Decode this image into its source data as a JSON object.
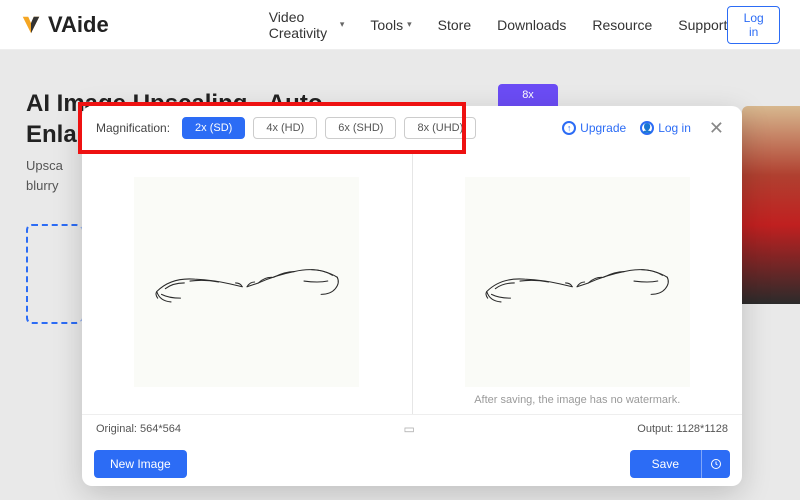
{
  "nav": {
    "brand": "VAide",
    "items": [
      "Video Creativity",
      "Tools",
      "Store",
      "Downloads",
      "Resource",
      "Support"
    ],
    "login": "Log in"
  },
  "hero": {
    "title": "AI Image Upscaling - Auto Enla",
    "sub1": "Upsca",
    "sub2": "blurry",
    "promo": "8x"
  },
  "modal": {
    "mag_label": "Magnification:",
    "options": [
      "2x (SD)",
      "4x (HD)",
      "6x (SHD)",
      "8x (UHD)"
    ],
    "upgrade": "Upgrade",
    "login": "Log in",
    "watermark_note": "After saving, the image has no watermark.",
    "original_label": "Original: 564*564",
    "output_label": "Output: 1128*1128",
    "new_image": "New Image",
    "save": "Save"
  }
}
